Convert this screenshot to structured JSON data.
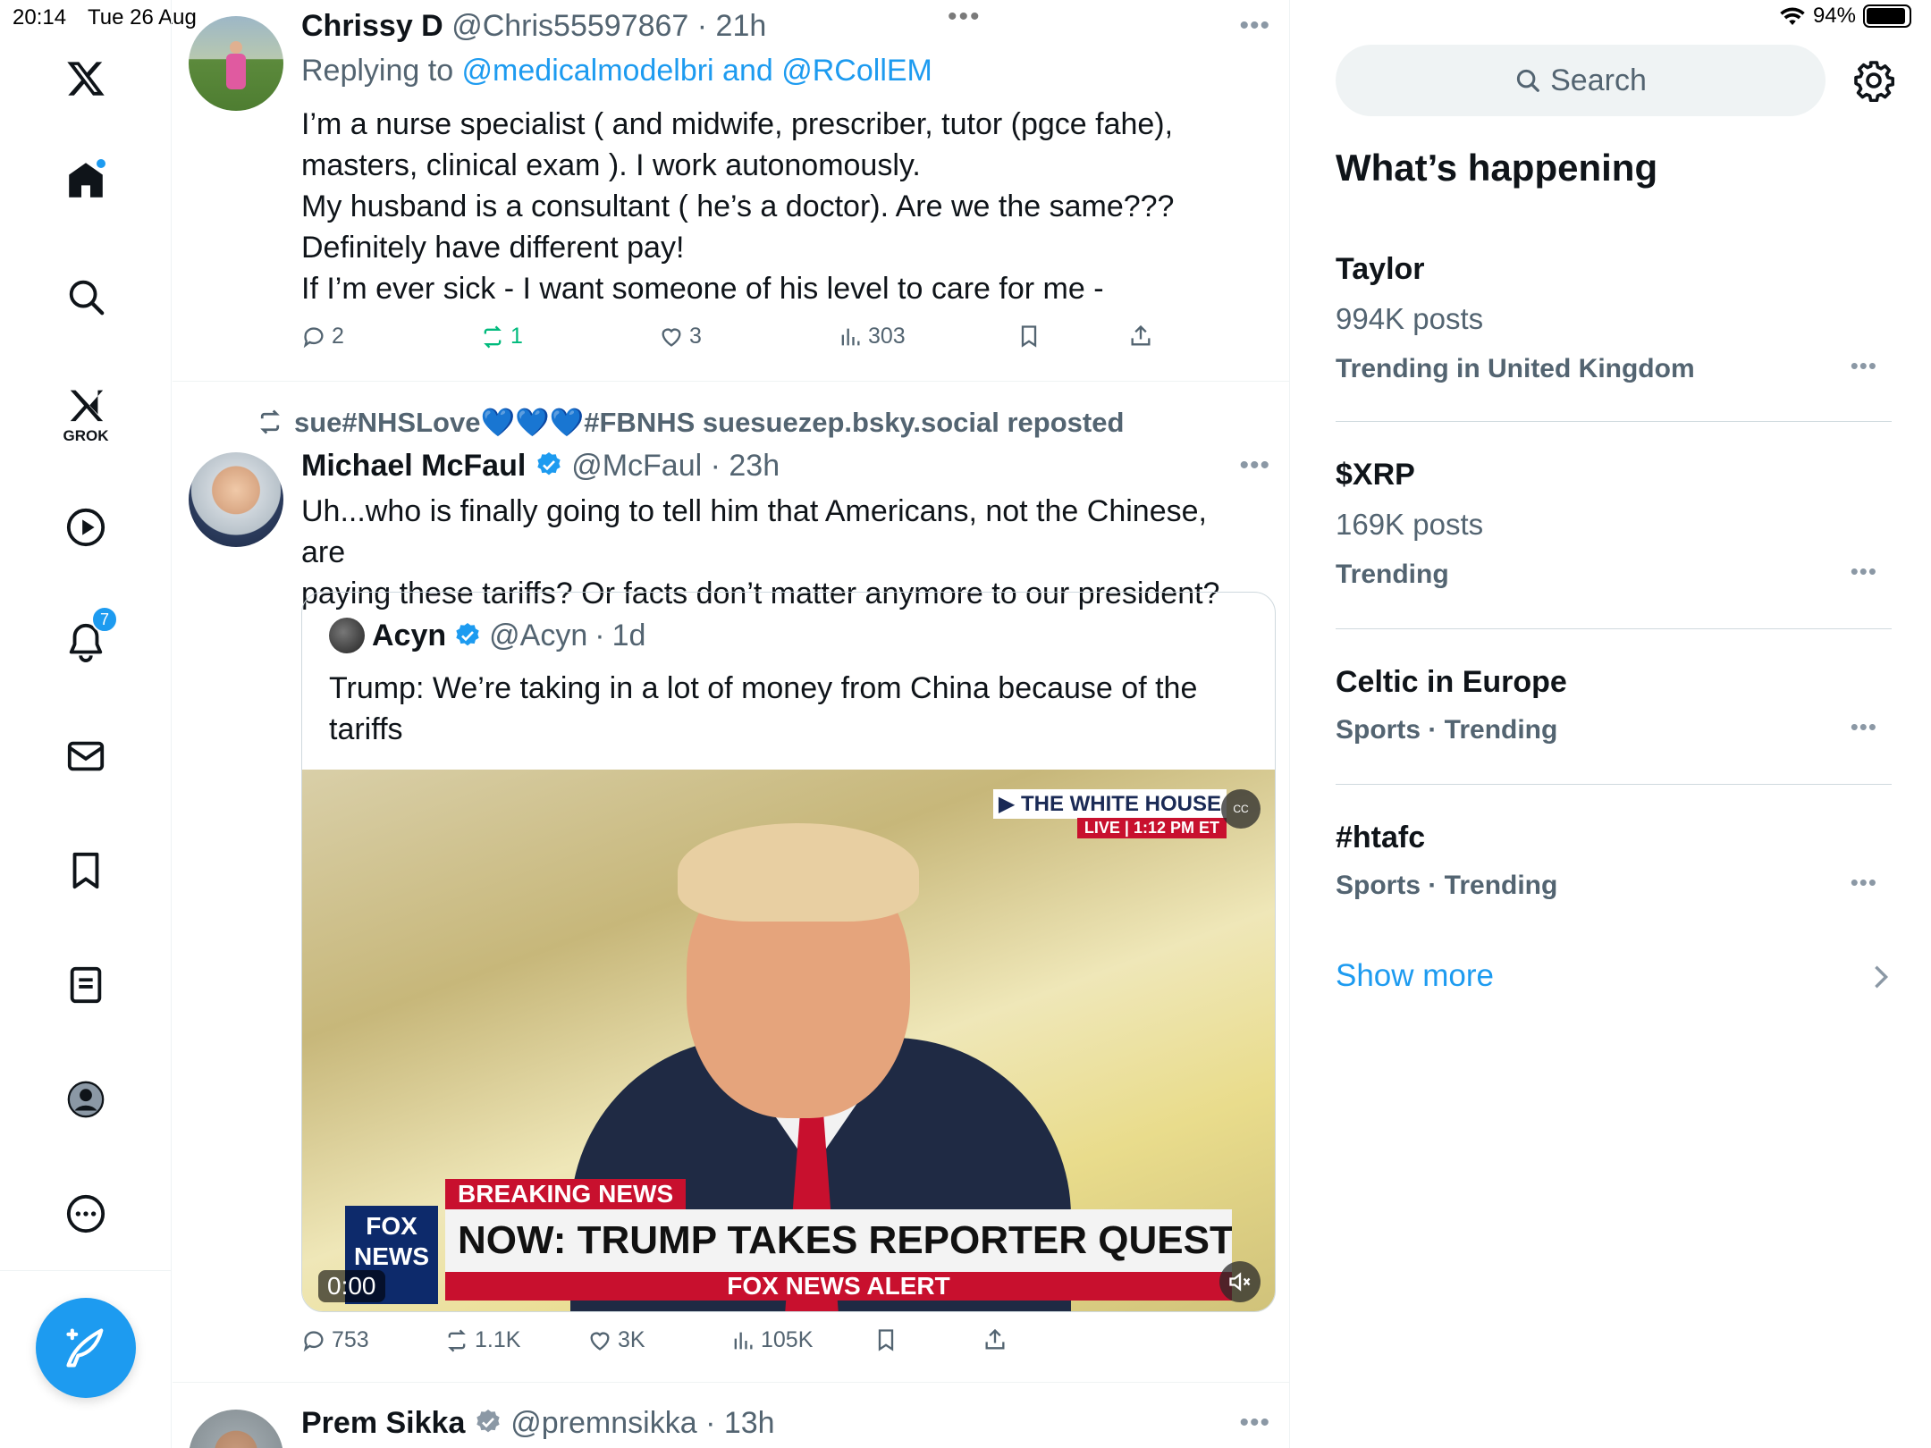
{
  "status_bar": {
    "time": "20:14",
    "date": "Tue 26 Aug",
    "battery": "94%",
    "battery_level": 0.94
  },
  "sidebar": {
    "grok_label": "GROK",
    "notifications_count": "7",
    "items": [
      "x-logo",
      "home-icon",
      "search-icon",
      "grok-icon",
      "video-icon",
      "notifications-icon",
      "messages-icon",
      "bookmarks-icon",
      "lists-icon",
      "profile-icon",
      "more-icon"
    ]
  },
  "timeline": {
    "tweet1": {
      "name": "Chrissy D",
      "handle": "@Chris55597867",
      "time": "21h",
      "replying_prefix": "Replying to ",
      "reply_to_1": "@medicalmodelbri",
      "reply_and": " and ",
      "reply_to_2": "@RCollEM",
      "lines": [
        "I’m a nurse specialist ( and midwife, prescriber, tutor (pgce fahe),",
        "masters, clinical exam ). I work autonomously.",
        "My husband is a consultant ( he’s a doctor). Are we the same???",
        "Definitely have different pay!",
        "If I’m ever sick - I want someone of his level to care for me -"
      ],
      "replies": "2",
      "reposts": "1",
      "likes": "3",
      "views": "303"
    },
    "tweet2": {
      "repost_label": "sue#NHSLove💙💙💙#FBNHS suesuezep.bsky.social reposted",
      "name": "Michael McFaul",
      "handle": "@McFaul",
      "time": "23h",
      "lines": [
        "Uh...who is finally going to tell him that Americans, not the Chinese, are",
        "paying these tariffs? Or facts don’t matter anymore to our president?"
      ],
      "quote": {
        "name": "Acyn",
        "handle": "@Acyn",
        "time": "1d",
        "lines": [
          "Trump: We’re taking in a lot of money from China because of the",
          "tariffs"
        ],
        "video": {
          "top_tag": "▶ THE WHITE HOUSE",
          "live_tag": "LIVE  |  1:12 PM ET",
          "cc": "CC",
          "breaking": "BREAKING NEWS",
          "headline": "NOW: TRUMP TAKES REPORTER QUESTIONS",
          "alert": "FOX NEWS ALERT",
          "logo": "FOX NEWS",
          "time": "0:00"
        }
      },
      "replies": "753",
      "reposts": "1.1K",
      "likes": "3K",
      "views": "105K"
    },
    "tweet3": {
      "name": "Prem Sikka",
      "handle": "@premnsikka",
      "time": "13h"
    },
    "separator": " · ",
    "more": "•••"
  },
  "right": {
    "search_placeholder": "Search",
    "section_title": "What’s happening",
    "trends": [
      {
        "title": "Taylor",
        "posts": "994K posts",
        "context": "Trending in United Kingdom"
      },
      {
        "title": "$XRP",
        "posts": "169K posts",
        "context": "Trending"
      },
      {
        "title": "Celtic in Europe",
        "posts": "",
        "context": "Sports · Trending"
      },
      {
        "title": "#htafc",
        "posts": "",
        "context": "Sports · Trending"
      }
    ],
    "show_more": "Show more"
  },
  "colors": {
    "accent": "#1d9bf0",
    "secondary_text": "#536471",
    "repost_green": "#00ba7c"
  }
}
